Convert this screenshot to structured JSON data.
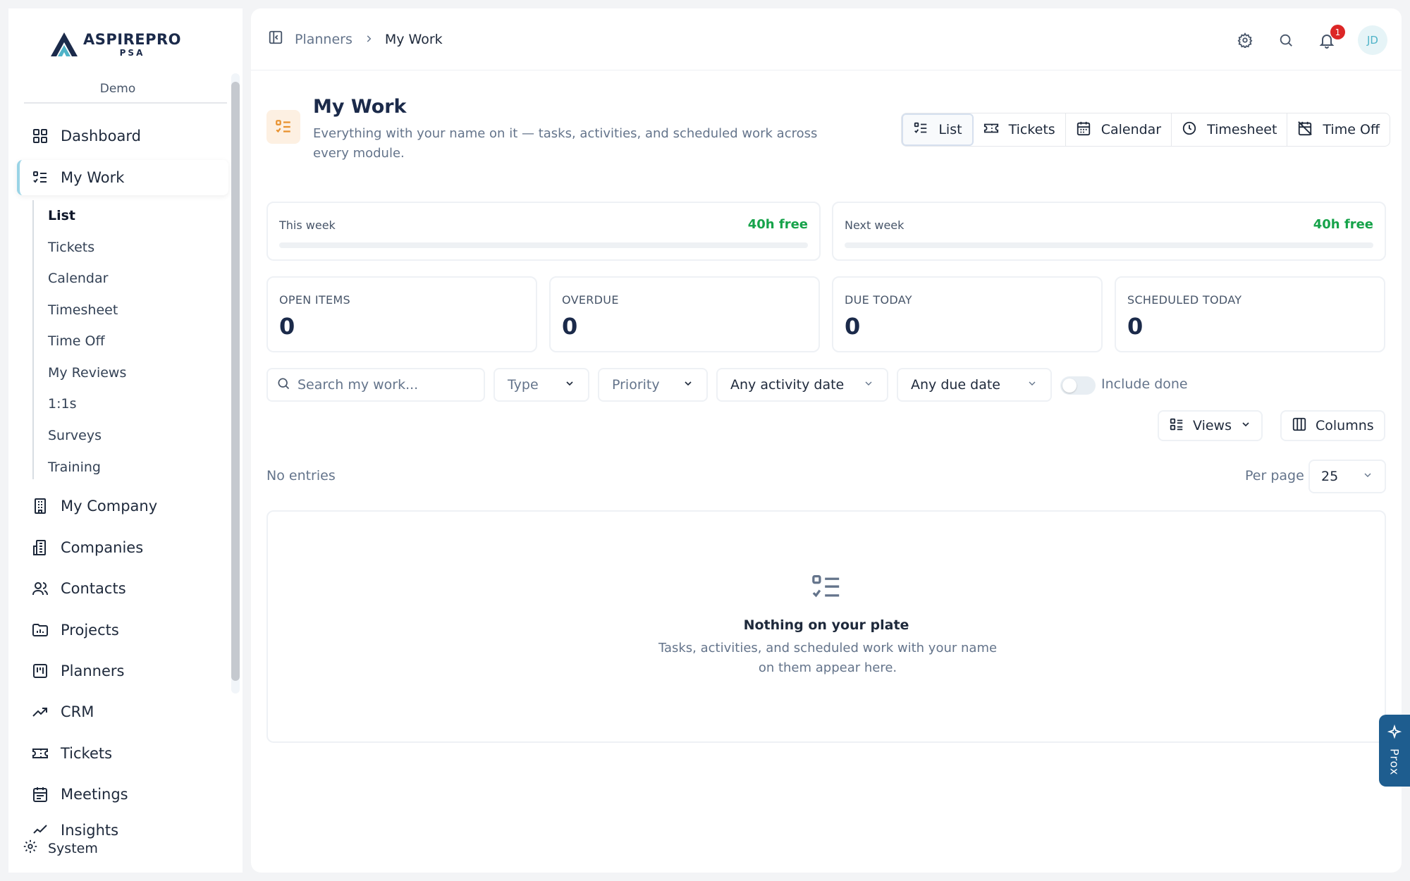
{
  "app": {
    "logo_title": "ASPIREPRO",
    "logo_sub": "PSA",
    "org": "Demo"
  },
  "sidebar": {
    "items": [
      {
        "label": "Dashboard",
        "icon": "dashboard-icon"
      },
      {
        "label": "My Work",
        "icon": "list-check-icon",
        "active": true
      },
      {
        "label": "My Company",
        "icon": "building-icon"
      },
      {
        "label": "Companies",
        "icon": "office-icon"
      },
      {
        "label": "Contacts",
        "icon": "users-icon"
      },
      {
        "label": "Projects",
        "icon": "folder-chart-icon"
      },
      {
        "label": "Planners",
        "icon": "kanban-icon"
      },
      {
        "label": "CRM",
        "icon": "trending-icon"
      },
      {
        "label": "Tickets",
        "icon": "ticket-icon"
      },
      {
        "label": "Meetings",
        "icon": "calendar-icon"
      },
      {
        "label": "Insights",
        "icon": "insights-icon"
      }
    ],
    "subitems": [
      "List",
      "Tickets",
      "Calendar",
      "Timesheet",
      "Time Off",
      "My Reviews",
      "1:1s",
      "Surveys",
      "Training"
    ],
    "system_label": "System"
  },
  "topbar": {
    "breadcrumb": [
      "Planners",
      "My Work"
    ],
    "notification_count": "1",
    "avatar_initials": "JD"
  },
  "page": {
    "title": "My Work",
    "description": "Everything with your name on it — tasks, activities, and scheduled work across every module."
  },
  "view_tabs": [
    "List",
    "Tickets",
    "Calendar",
    "Timesheet",
    "Time Off"
  ],
  "weeks": [
    {
      "label": "This week",
      "free": "40h free",
      "fill": 0
    },
    {
      "label": "Next week",
      "free": "40h free",
      "fill": 0
    }
  ],
  "stats": [
    {
      "label": "OPEN ITEMS",
      "value": "0"
    },
    {
      "label": "OVERDUE",
      "value": "0"
    },
    {
      "label": "DUE TODAY",
      "value": "0"
    },
    {
      "label": "SCHEDULED TODAY",
      "value": "0"
    }
  ],
  "filters": {
    "search_placeholder": "Search my work...",
    "type": "Type",
    "priority": "Priority",
    "activity_date": "Any activity date",
    "due_date": "Any due date",
    "include_done": "Include done",
    "include_done_on": false
  },
  "list_controls": {
    "views": "Views",
    "columns": "Columns"
  },
  "list": {
    "status": "No entries",
    "per_page_label": "Per page",
    "per_page": "25"
  },
  "empty_state": {
    "title": "Nothing on your plate",
    "description": "Tasks, activities, and scheduled work with your name on them appear here."
  },
  "assistant": {
    "label": "Prox"
  },
  "colors": {
    "accent_green": "#16a34a",
    "brand_navy": "#1b2a4a",
    "assistant_blue": "#1e5d8f",
    "badge_red": "#dc2626"
  }
}
